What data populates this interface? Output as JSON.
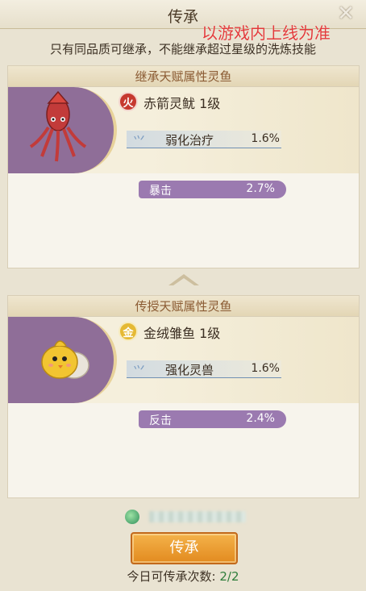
{
  "header": {
    "title": "传承",
    "watermark": "以游戏内上线为准",
    "close_icon": "close-icon"
  },
  "tip": "只有同品质可继承，不能继承超过星级的洗炼技能",
  "inherit_panel": {
    "title": "继承天赋属性灵鱼",
    "element_badge": "火",
    "fish_name": "赤箭灵鱿 1级",
    "skill": {
      "name": "弱化治疗",
      "value": "1.6%"
    },
    "attribute": {
      "name": "暴击",
      "value": "2.7%"
    }
  },
  "transfer_panel": {
    "title": "传授天赋属性灵鱼",
    "element_badge": "金",
    "fish_name": "金绒雏鱼 1级",
    "skill": {
      "name": "强化灵兽",
      "value": "1.6%"
    },
    "attribute": {
      "name": "反击",
      "value": "2.4%"
    }
  },
  "actions": {
    "inherit_button": "传承",
    "daily_label": "今日可传承次数:",
    "daily_count": "2/2"
  },
  "colors": {
    "accent_orange": "#e28a1f",
    "attr_pill": "#9b7ab0",
    "watermark_red": "#e23a3a",
    "count_green": "#2e7d3a"
  }
}
